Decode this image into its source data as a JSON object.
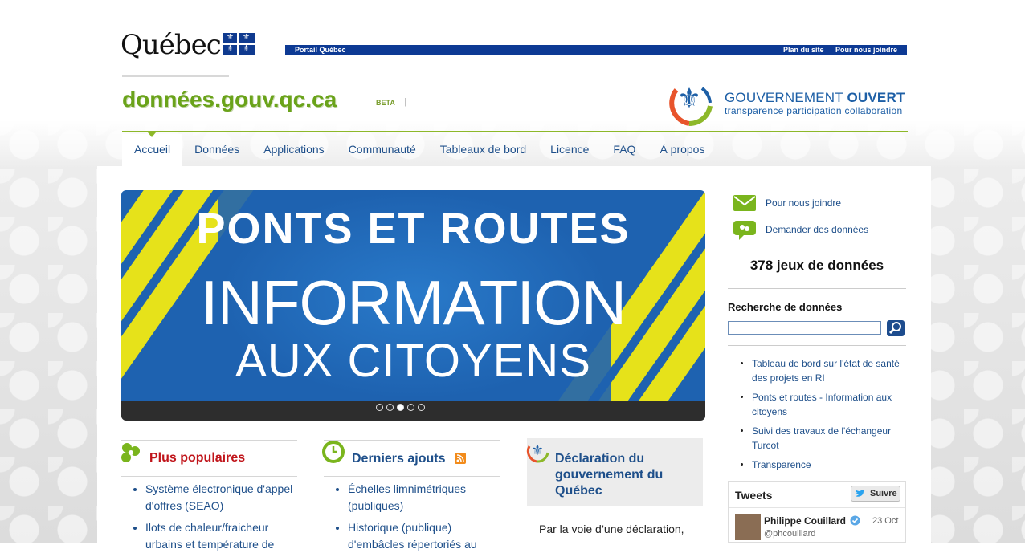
{
  "header": {
    "quebec_logo": "Québec",
    "portal_link": "Portail Québec",
    "sitemap_link": "Plan du site",
    "contact_link": "Pour nous joindre",
    "site_title": "données.gouv.qc.ca",
    "beta": "BETA",
    "go_title_a": "GOUVERNEMENT ",
    "go_title_b": "OUVERT",
    "go_subtitle": "transparence  participation  collaboration"
  },
  "nav": [
    "Accueil",
    "Données",
    "Applications",
    "Communauté",
    "Tableaux de bord",
    "Licence",
    "FAQ",
    "À propos"
  ],
  "slider": {
    "line1": "PONTS ET ROUTES",
    "line2": "INFORMATION",
    "line3": "AUX CITOYENS",
    "active_slide_index": 2,
    "slide_count": 5
  },
  "columns": {
    "popular": {
      "title": "Plus populaires",
      "items": [
        "Système électronique d'appel",
        "d'offres (SEAO)",
        "Ilots de chaleur/fraicheur",
        "urbains et température de"
      ]
    },
    "latest": {
      "title": "Derniers ajouts",
      "items": [
        "Échelles limnimétriques",
        "(publiques)",
        "Historique (publique)",
        "d'embâcles répertoriés au"
      ]
    },
    "declaration": {
      "title_l1": "Déclaration du",
      "title_l2": "gouvernement du",
      "title_l3": "Québec",
      "body": "Par la voie d’une déclaration,"
    }
  },
  "sidebar": {
    "contact": "Pour nous joindre",
    "request": "Demander des données",
    "count_text": "378 jeux de données",
    "search_label": "Recherche de données",
    "search_value": "",
    "links": [
      [
        "Tableau de bord sur l'état de santé",
        "des projets en RI"
      ],
      [
        "Ponts et routes - Information aux",
        "citoyens"
      ],
      [
        "Suivi des travaux de l'échangeur",
        "Turcot"
      ],
      [
        "Transparence"
      ]
    ],
    "tweets": {
      "title": "Tweets",
      "follow": "Suivre",
      "name": "Philippe Couillard",
      "handle": "@phcouillard",
      "date": "23 Oct"
    }
  },
  "colors": {
    "brand_blue": "#0d3a94",
    "title_green": "#6aa31a",
    "nav_blue": "#1e4f8a",
    "popular_red": "#c0141a",
    "slide_yellow": "#e6e21a"
  }
}
